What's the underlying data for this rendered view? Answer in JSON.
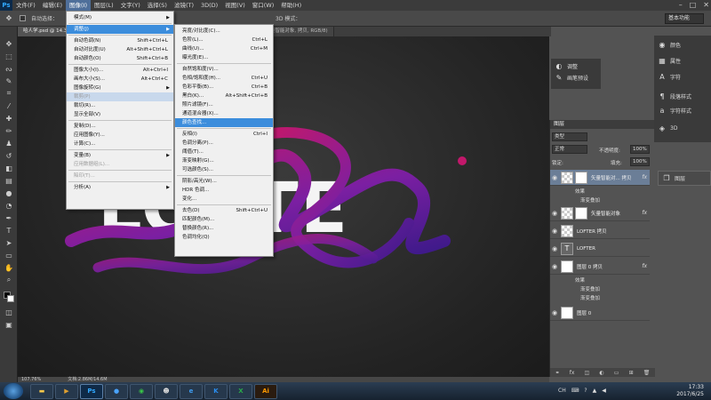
{
  "menubar": {
    "logo": "Ps",
    "items": [
      "文件(F)",
      "编辑(E)",
      "图像(I)",
      "图层(L)",
      "文字(Y)",
      "选择(S)",
      "滤镜(T)",
      "3D(D)",
      "视图(V)",
      "窗口(W)",
      "帮助(H)"
    ],
    "active_index": 2,
    "window_controls": [
      "–",
      "□",
      "✕"
    ]
  },
  "options": {
    "auto_select": "自动选择：",
    "mode_3d": "3D 模式：",
    "workspace": "基本功能"
  },
  "doc_tabs": {
    "tab1": "哈人学.psd @ 14.3",
    "tab2": "矢量智能对象, 拷贝, RGB/8)"
  },
  "image_menu": [
    {
      "label": "模式(M)",
      "arrow": true
    },
    {
      "sep": true
    },
    {
      "label": "调整(J)",
      "arrow": true,
      "highlight": true
    },
    {
      "sep": true
    },
    {
      "label": "自动色调(N)",
      "shortcut": "Shift+Ctrl+L"
    },
    {
      "label": "自动对比度(U)",
      "shortcut": "Alt+Shift+Ctrl+L"
    },
    {
      "label": "自动颜色(O)",
      "shortcut": "Shift+Ctrl+B"
    },
    {
      "sep": true
    },
    {
      "label": "图像大小(I)...",
      "shortcut": "Alt+Ctrl+I"
    },
    {
      "label": "画布大小(S)...",
      "shortcut": "Alt+Ctrl+C"
    },
    {
      "label": "图像旋转(G)",
      "arrow": true
    },
    {
      "label": "裁剪(P)",
      "disabled": true,
      "soft": true
    },
    {
      "label": "裁切(R)..."
    },
    {
      "label": "显示全部(V)"
    },
    {
      "sep": true
    },
    {
      "label": "复制(D)..."
    },
    {
      "label": "应用图像(Y)..."
    },
    {
      "label": "计算(C)..."
    },
    {
      "sep": true
    },
    {
      "label": "变量(B)",
      "arrow": true
    },
    {
      "label": "应用数据组(L)...",
      "disabled": true
    },
    {
      "sep": true
    },
    {
      "label": "陷印(T)...",
      "disabled": true
    },
    {
      "sep": true
    },
    {
      "label": "分析(A)",
      "arrow": true
    }
  ],
  "adjust_menu": [
    {
      "label": "亮度/对比度(C)..."
    },
    {
      "label": "色阶(L)...",
      "shortcut": "Ctrl+L"
    },
    {
      "label": "曲线(U)...",
      "shortcut": "Ctrl+M"
    },
    {
      "label": "曝光度(E)..."
    },
    {
      "sep": true
    },
    {
      "label": "自然饱和度(V)..."
    },
    {
      "label": "色相/饱和度(H)...",
      "shortcut": "Ctrl+U"
    },
    {
      "label": "色彩平衡(B)...",
      "shortcut": "Ctrl+B"
    },
    {
      "label": "黑白(K)...",
      "shortcut": "Alt+Shift+Ctrl+B"
    },
    {
      "label": "照片滤镜(F)..."
    },
    {
      "label": "通道混合器(X)..."
    },
    {
      "label": "颜色查找...",
      "highlight": true
    },
    {
      "sep": true
    },
    {
      "label": "反相(I)",
      "shortcut": "Ctrl+I"
    },
    {
      "label": "色调分离(P)..."
    },
    {
      "label": "阈值(T)..."
    },
    {
      "label": "渐变映射(G)..."
    },
    {
      "label": "可选颜色(S)..."
    },
    {
      "sep": true
    },
    {
      "label": "阴影/高光(W)..."
    },
    {
      "label": "HDR 色调..."
    },
    {
      "label": "变化..."
    },
    {
      "sep": true
    },
    {
      "label": "去色(D)",
      "shortcut": "Shift+Ctrl+U"
    },
    {
      "label": "匹配颜色(M)..."
    },
    {
      "label": "替换颜色(R)..."
    },
    {
      "label": "色调均化(Q)"
    }
  ],
  "history_panel": {
    "items": [
      "调整",
      "画笔预设"
    ]
  },
  "props_dock": {
    "items": [
      "颜色",
      "属性",
      "字符",
      "段落样式",
      "字符样式",
      "3D"
    ]
  },
  "layers_dock_tab": "图层",
  "layers_panel": {
    "title": "图层",
    "kind": "类型",
    "blend_mode": "正常",
    "opacity_label": "不透明度:",
    "opacity_value": "100%",
    "lock_label": "锁定:",
    "fill_label": "填充:",
    "fill_value": "100%",
    "layers": [
      {
        "name": "矢量智能对... 拷贝",
        "fx": "fx",
        "selected": true,
        "thumb": "checker",
        "effects_label": "效果",
        "effects": [
          "渐变叠加"
        ]
      },
      {
        "name": "矢量智能对象",
        "fx": "fx",
        "thumb": "checker",
        "effects_label": "",
        "effects": []
      },
      {
        "name": "LOFTER 拷贝",
        "thumb": "checker"
      },
      {
        "name": "LOFTER",
        "thumb": "text"
      },
      {
        "name": "图层 0 拷贝",
        "fx": "fx",
        "thumb": "white",
        "effects_label": "效果",
        "effects": [
          "渐变叠加",
          "渐变叠加"
        ]
      },
      {
        "name": "图层 0",
        "thumb": "white"
      }
    ],
    "footer_icons": [
      "link-icon",
      "fx-icon",
      "mask-icon",
      "adjustment-icon",
      "folder-icon",
      "new-layer-icon",
      "trash-icon"
    ]
  },
  "statusbar": {
    "zoom": "107.76%",
    "doc": "文档:2.86M/14.6M"
  },
  "canvas_art": {
    "word": "LOFTE",
    "tube_colors": [
      "#c2186b",
      "#7b1fa2",
      "#3f1a8a"
    ]
  },
  "taskbar": {
    "apps": [
      "ps-icon",
      "browser-icon",
      "wechat-icon",
      "user-icon",
      "ie-icon",
      "k-icon",
      "excel-icon",
      "ai-icon"
    ],
    "app_labels": [
      "Ps",
      "e",
      "K",
      "X",
      "Ai"
    ],
    "tray_text": "CH",
    "time": "17:33",
    "date": "2017/6/25"
  }
}
